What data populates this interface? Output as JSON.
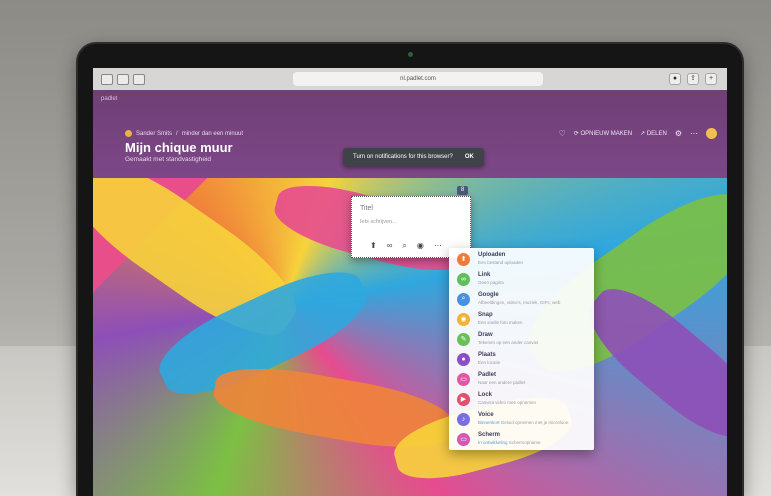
{
  "browser": {
    "url": "nl.padlet.com"
  },
  "padlet": {
    "brand": "padlet",
    "breadcrumb": {
      "user": "Sander Smits",
      "separator": "/",
      "page": "minder dan een minuut"
    },
    "title": "Mijn chique muur",
    "subtitle": "Gemaakt met standvastigheid",
    "actions": {
      "remake": "OPNIEUW MAKEN",
      "share": "DELEN"
    }
  },
  "toast": {
    "message": "Turn on notifications for this browser?",
    "ok": "OK"
  },
  "composer": {
    "title_placeholder": "Titel",
    "body_placeholder": "Iets schrijven...",
    "badge": "8"
  },
  "attach_menu": [
    {
      "label": "Uploaden",
      "desc": "Een bestand uploaden",
      "icon": "upload-icon",
      "color": "#ef7b3b",
      "glyph": "⬆"
    },
    {
      "label": "Link",
      "desc": "Geen pagina",
      "icon": "link-icon",
      "color": "#5fc05a",
      "glyph": "∞"
    },
    {
      "label": "Google",
      "desc": "Afbeeldingen, video's, muziek, GIFs, web",
      "icon": "google-icon",
      "color": "#4a90e2",
      "glyph": "⌕"
    },
    {
      "label": "Snap",
      "desc": "Een snelle foto maken",
      "icon": "camera-icon",
      "color": "#f2b233",
      "glyph": "◉"
    },
    {
      "label": "Draw",
      "desc": "Tekenen op een ander canvas",
      "icon": "draw-icon",
      "color": "#6bbf59",
      "glyph": "✎"
    },
    {
      "label": "Plaats",
      "desc": "Een locatie",
      "icon": "location-icon",
      "color": "#8a4fc5",
      "glyph": "●"
    },
    {
      "label": "Padlet",
      "desc": "Naar een andere padlet",
      "icon": "padlet-icon",
      "color": "#e356a6",
      "glyph": "▭"
    },
    {
      "label": "Lock",
      "desc": "Camera video mee opnemen",
      "icon": "video-icon",
      "color": "#e2506e",
      "glyph": "▶"
    },
    {
      "label": "Voice",
      "desc": "Geluid opnemen met je microfoon",
      "desc_highlight": "Binnenkort",
      "icon": "microphone-icon",
      "color": "#7b6ee0",
      "glyph": "♪"
    },
    {
      "label": "Scherm",
      "desc": "Schermopname",
      "desc_highlight": "In ontwikkeling",
      "icon": "screen-icon",
      "color": "#d656b4",
      "glyph": "▭"
    }
  ]
}
